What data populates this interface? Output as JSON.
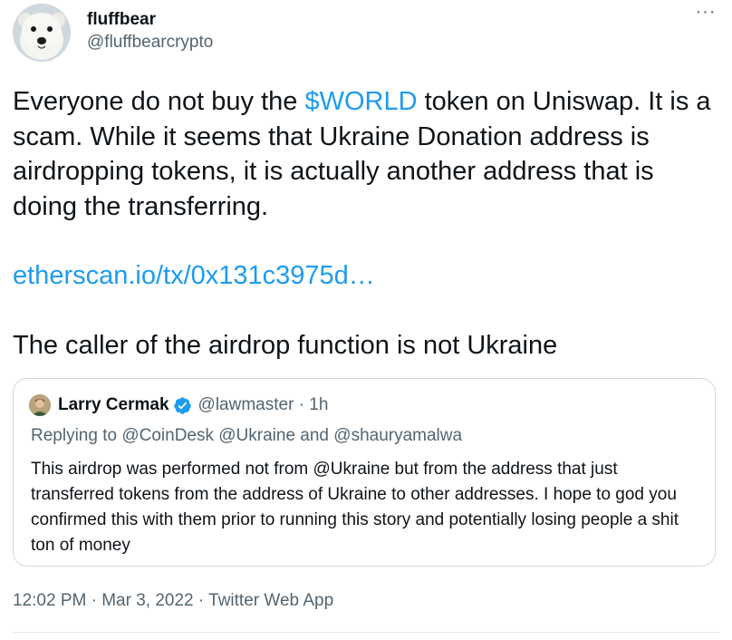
{
  "author": {
    "display_name": "fluffbear",
    "handle": "@fluffbearcrypto"
  },
  "more_menu": "···",
  "tweet": {
    "para1_before": "Everyone do not buy the ",
    "cashtag": "$WORLD",
    "para1_after": " token on Uniswap. It is a scam. While it seems that Ukraine Donation address is airdropping tokens, it is actually another address that is doing the transferring.",
    "link": "etherscan.io/tx/0x131c3975d…",
    "para3": "The caller of the airdrop function is not Ukraine"
  },
  "quoted": {
    "display_name": "Larry Cermak",
    "handle_time": "@lawmaster · 1h",
    "replying_to": "Replying to @CoinDesk @Ukraine and @shauryamalwa",
    "text": "This airdrop was performed not from @Ukraine but from the address that just transferred tokens from the address of Ukraine to other addresses. I hope to god you confirmed this with them prior to running this story and potentially losing people a shit ton of money"
  },
  "meta": "12:02 PM · Mar 3, 2022 · Twitter Web App",
  "colors": {
    "link": "#1d9bf0",
    "secondary_text": "#536471",
    "primary_text": "#0f1419",
    "border": "#cfd9de"
  },
  "icons": {
    "avatar": "polar-bear-avatar",
    "quoted_avatar": "person-avatar",
    "verified": "verified-badge-icon",
    "more": "more-horizontal-icon"
  }
}
